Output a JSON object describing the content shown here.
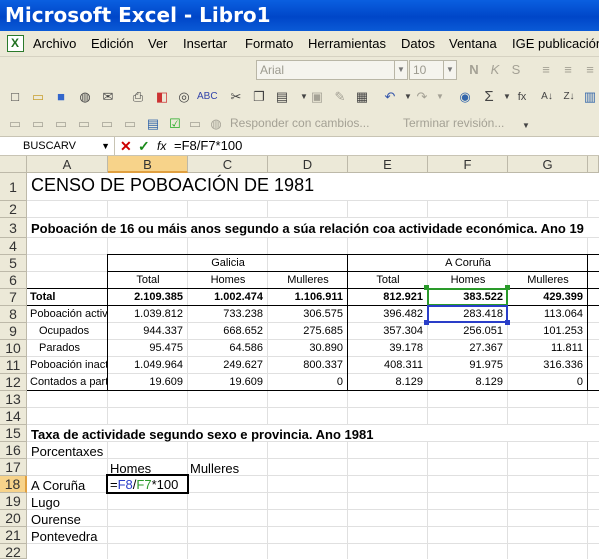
{
  "window": {
    "title": "Microsoft Excel - Libro1"
  },
  "menu": [
    "Archivo",
    "Edición",
    "Ver",
    "Insertar",
    "Formato",
    "Herramientas",
    "Datos",
    "Ventana",
    "IGE publicación"
  ],
  "toolbar": {
    "font": "Arial",
    "size": "10",
    "review_reply": "Responder con cambios...",
    "review_end": "Terminar revisión..."
  },
  "formula_bar": {
    "name_box": "BUSCARV",
    "content": "=F8/F7*100"
  },
  "columns": [
    "A",
    "B",
    "C",
    "D",
    "E",
    "F",
    "G"
  ],
  "rows": [
    "1",
    "2",
    "3",
    "4",
    "5",
    "6",
    "7",
    "8",
    "9",
    "10",
    "11",
    "12",
    "13",
    "14",
    "15",
    "16",
    "17",
    "18",
    "19",
    "20",
    "21",
    "22"
  ],
  "sheet": {
    "title": "CENSO DE POBOACIÓN DE 1981",
    "subtitle": "Poboación de 16 ou máis anos segundo a súa relación coa actividade económica. Ano 19",
    "region1": "Galicia",
    "region2": "A Coruña",
    "headers": [
      "Total",
      "Homes",
      "Mulleres",
      "Total",
      "Homes",
      "Mulleres"
    ],
    "table": [
      {
        "label": "Total",
        "values": [
          "2.109.385",
          "1.002.474",
          "1.106.911",
          "812.921",
          "383.522",
          "429.399"
        ]
      },
      {
        "label": "Poboación activa",
        "values": [
          "1.039.812",
          "733.238",
          "306.575",
          "396.482",
          "283.418",
          "113.064"
        ]
      },
      {
        "label": "Ocupados",
        "values": [
          "944.337",
          "668.652",
          "275.685",
          "357.304",
          "256.051",
          "101.253"
        ]
      },
      {
        "label": "Parados",
        "values": [
          "95.475",
          "64.586",
          "30.890",
          "39.178",
          "27.367",
          "11.811"
        ]
      },
      {
        "label": "Poboación inactiva",
        "values": [
          "1.049.964",
          "249.627",
          "800.337",
          "408.311",
          "91.975",
          "316.336"
        ]
      },
      {
        "label": "Contados a parte",
        "values": [
          "19.609",
          "19.609",
          "0",
          "8.129",
          "8.129",
          "0"
        ]
      }
    ],
    "section2_title": "Taxa de actividade segundo sexo e provincia. Ano 1981",
    "section2_sub": "Porcentaxes",
    "section2_headers": [
      "Homes",
      "Mulleres"
    ],
    "provinces": [
      "A Coruña",
      "Lugo",
      "Ourense",
      "Pontevedra"
    ],
    "editing_formula": {
      "eq": "=",
      "ref1": "F8",
      "slash": "/",
      "ref2": "F7",
      "tail": "*100"
    }
  }
}
